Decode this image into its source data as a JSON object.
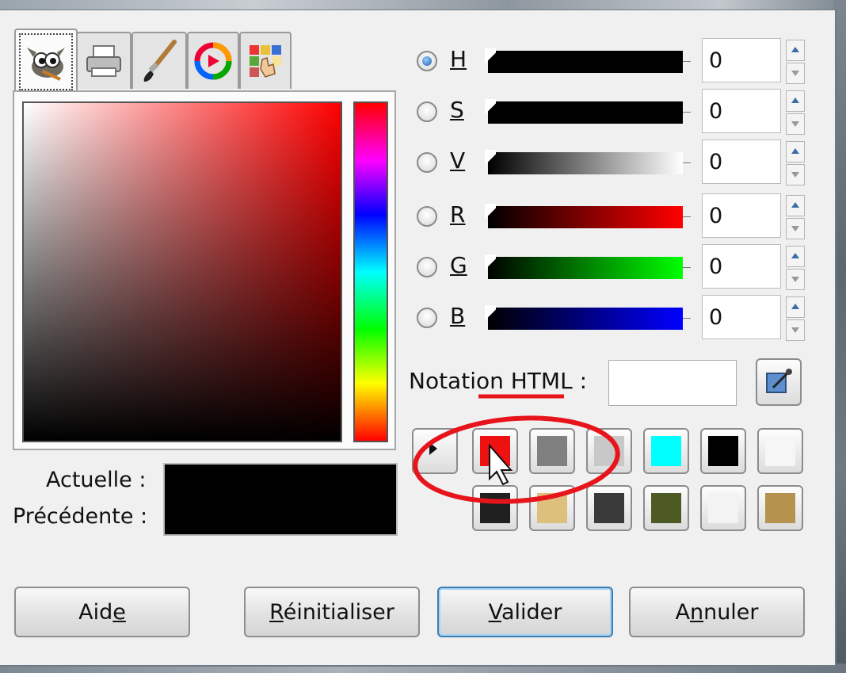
{
  "tabs": [
    {
      "name": "gimp-icon",
      "active": true
    },
    {
      "name": "printer-icon",
      "active": false
    },
    {
      "name": "paintbrush-icon",
      "active": false
    },
    {
      "name": "color-wheel-icon",
      "active": false
    },
    {
      "name": "palette-icon",
      "active": false
    }
  ],
  "labels": {
    "current": "Actuelle :",
    "previous": "Précédente :"
  },
  "channels": [
    {
      "key": "H",
      "selected": true,
      "value": "0"
    },
    {
      "key": "S",
      "selected": false,
      "value": "0"
    },
    {
      "key": "V",
      "selected": false,
      "value": "0"
    },
    {
      "key": "R",
      "selected": false,
      "value": "0"
    },
    {
      "key": "G",
      "selected": false,
      "value": "0"
    },
    {
      "key": "B",
      "selected": false,
      "value": "0"
    }
  ],
  "html_notation": {
    "label": "Notation HTML :",
    "value": ""
  },
  "history_colors": [
    "#ee1111",
    "#808080",
    "#c8c8c8",
    "#00ffff",
    "#000000",
    "#f6f6f6",
    "#202020",
    "#dcc07c",
    "#3a3a3a",
    "#4e5a23",
    "#f3f3f3",
    "#b5924e"
  ],
  "buttons": {
    "help": {
      "prefix": "Aid",
      "mnemonic": "e",
      "suffix": ""
    },
    "reset": {
      "prefix": "",
      "mnemonic": "R",
      "suffix": "éinitialiser"
    },
    "ok": {
      "prefix": "",
      "mnemonic": "V",
      "suffix": "alider"
    },
    "cancel": {
      "prefix": "A",
      "mnemonic": "n",
      "suffix": "nuler"
    }
  },
  "colors": {
    "annotation": "#e8141c",
    "accent": "#3c7fb1"
  }
}
